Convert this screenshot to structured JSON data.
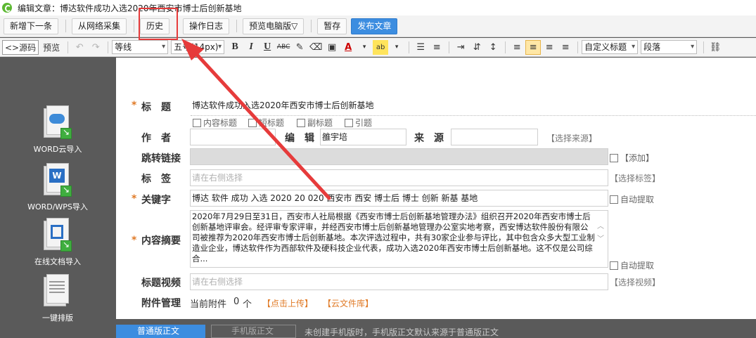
{
  "window": {
    "title": "编辑文章：博达软件成功入选2020年西安市博士后创新基地"
  },
  "topbar": {
    "buttons": [
      "新增下一条",
      "从网络采集",
      "历史",
      "操作日志",
      "预览电脑版▽",
      "暂存",
      "发布文章"
    ]
  },
  "toolbar": {
    "source": "<>源码",
    "preview": "预览",
    "font": "等线",
    "size": "五号(14px)",
    "heading": "自定义标题",
    "paragraph": "段落"
  },
  "sidebar": {
    "items": [
      "WORD云导入",
      "WORD/WPS导入",
      "在线文档导入",
      "一键排版"
    ]
  },
  "form": {
    "title_label": "标　题",
    "title_value": "博达软件成功入选2020年西安市博士后创新基地",
    "title_checks": [
      "内容标题",
      "短标题",
      "副标题",
      "引题"
    ],
    "author_label": "作　者",
    "author_value": "",
    "editor_label": "编　辑",
    "editor_value": "雒宇培",
    "source_label": "来　源",
    "source_value": "",
    "source_link": "【选择来源】",
    "redirect_label": "跳转链接",
    "redirect_add": "【添加】",
    "tags_label": "标　签",
    "tags_placeholder": "请在右侧选择",
    "tags_link": "【选择标签】",
    "keywords_label": "关键字",
    "keywords_value": "博达 软件 成功 入选 2020 20 020 西安市 西安 博士后 博士 创新 新基 基地",
    "keywords_auto": "自动提取",
    "summary_label": "内容摘要",
    "summary_value": "2020年7月29日至31日，西安市人社局根据《西安市博士后创新基地管理办法》组织召开2020年西安市博士后创新基地评审会。经评审专家评审，并经西安市博士后创新基地管理办公室实地考察，西安博达软件股份有限公司被推荐为2020年西安市博士后创新基地。本次评选过程中，共有30家企业参与评比，其中包含众多大型工业制造业企业，博达软件作为西部软件及硬科技企业代表，成功入选2020年西安市博士后创新基地。这不仅是公司综合...",
    "summary_auto": "自动提取",
    "video_label": "标题视频",
    "video_placeholder": "请在右侧选择",
    "video_link": "【选择视频】",
    "attach_label": "附件管理",
    "attach_current": "当前附件",
    "attach_count": "0",
    "attach_unit": "个",
    "attach_upload": "【点击上传】",
    "attach_cloud": "【云文件库】"
  },
  "bottom": {
    "tab_normal": "普通版正文",
    "tab_mobile": "手机版正文",
    "note": "未创建手机版时，手机版正文默认来源于普通版正文"
  },
  "colors": {
    "accent": "#3c8de0",
    "highlight": "#e63b3b",
    "required": "#e07a26"
  }
}
